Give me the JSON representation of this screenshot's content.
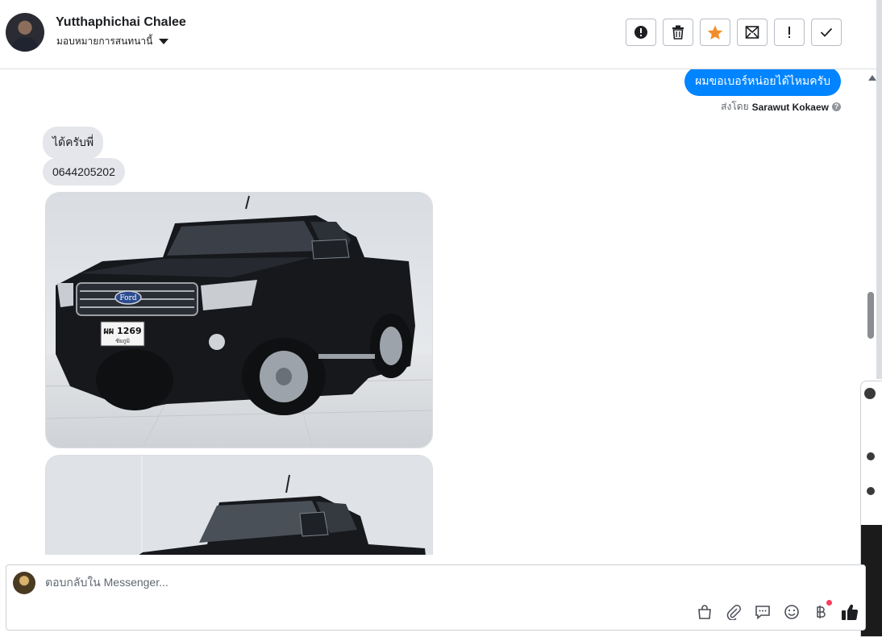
{
  "header": {
    "contact_name": "Yutthaphichai Chalee",
    "assign_label": "มอบหมายการสนทนานี้",
    "actions": [
      {
        "icon": "alert-circle-icon",
        "name": "mark-spam-button"
      },
      {
        "icon": "trash-icon",
        "name": "delete-button"
      },
      {
        "icon": "star-icon",
        "name": "star-button"
      },
      {
        "icon": "mark-unread-icon",
        "name": "mark-unread-button"
      },
      {
        "icon": "exclamation-icon",
        "name": "follow-up-button"
      },
      {
        "icon": "check-icon",
        "name": "mark-done-button"
      }
    ],
    "star_color": "#f28c28"
  },
  "messages": {
    "sent": {
      "text": "ผมขอเบอร์หน่อยได้ไหมครับ",
      "sent_by_prefix": "ส่งโดย",
      "sender": "Sarawut Kokaew",
      "bubble_color": "#0084ff"
    },
    "received": [
      {
        "text": "ได้ครับพี่"
      },
      {
        "text": "0644205202"
      }
    ],
    "photos": [
      {
        "plate_line1": "ผผ 1269",
        "plate_line2": "ชัยภูมิ",
        "brand_badge": "Ford"
      },
      {
        "plate_line1": "",
        "plate_line2": "",
        "brand_badge": ""
      }
    ]
  },
  "composer": {
    "placeholder": "ตอบกลับใน Messenger...",
    "tools": [
      "shopping-bag-icon",
      "paperclip-icon",
      "saved-reply-icon",
      "emoji-icon",
      "baht-payment-icon",
      "thumbs-up-icon"
    ],
    "notification_dot_color": "#fa3e5e",
    "like_color": "#1c1e21"
  }
}
